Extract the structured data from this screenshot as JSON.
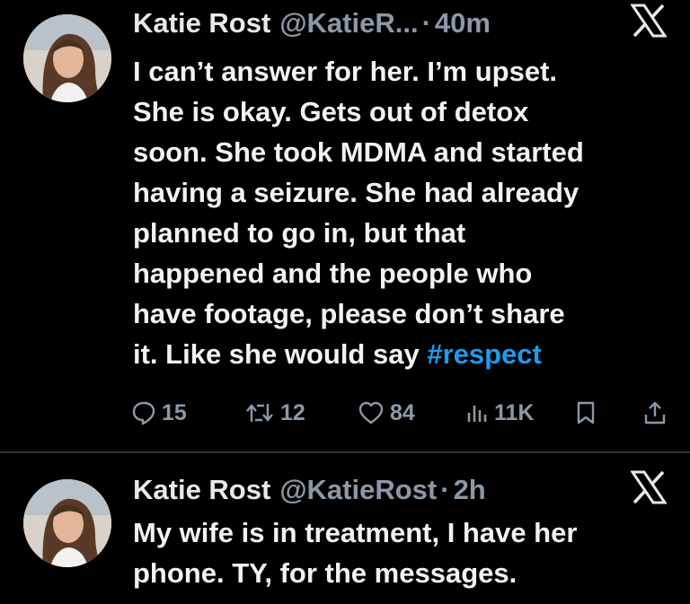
{
  "tweets": [
    {
      "author_name": "Katie Rost",
      "handle": "@KatieR...",
      "separator": "·",
      "time": "40m",
      "text_lines": [
        "I can’t answer for her. I’m upset.",
        "She is okay. Gets out of detox",
        "soon. She took MDMA and started",
        "having a seizure. She had already",
        "planned to go in, but that",
        "happened and the people who",
        "have footage, please don’t share",
        "it. Like she would say "
      ],
      "hashtag": "#respect",
      "stats": {
        "replies": "15",
        "reposts": "12",
        "likes": "84",
        "views": "11K"
      }
    },
    {
      "author_name": "Katie Rost",
      "handle": "@KatieRost",
      "separator": "·",
      "time": "2h",
      "text_lines": [
        "My wife is in treatment, I have her",
        "phone. TY, for the messages."
      ]
    }
  ],
  "x_logo": "𝕏",
  "colors": {
    "background": "#000000",
    "text": "#e7e9ea",
    "muted": "#8b98a5",
    "link": "#1d9bf0",
    "divider": "#2f3336"
  },
  "icons": [
    "reply-icon",
    "repost-icon",
    "like-icon",
    "views-icon",
    "bookmark-icon",
    "share-icon",
    "x-logo-icon"
  ]
}
